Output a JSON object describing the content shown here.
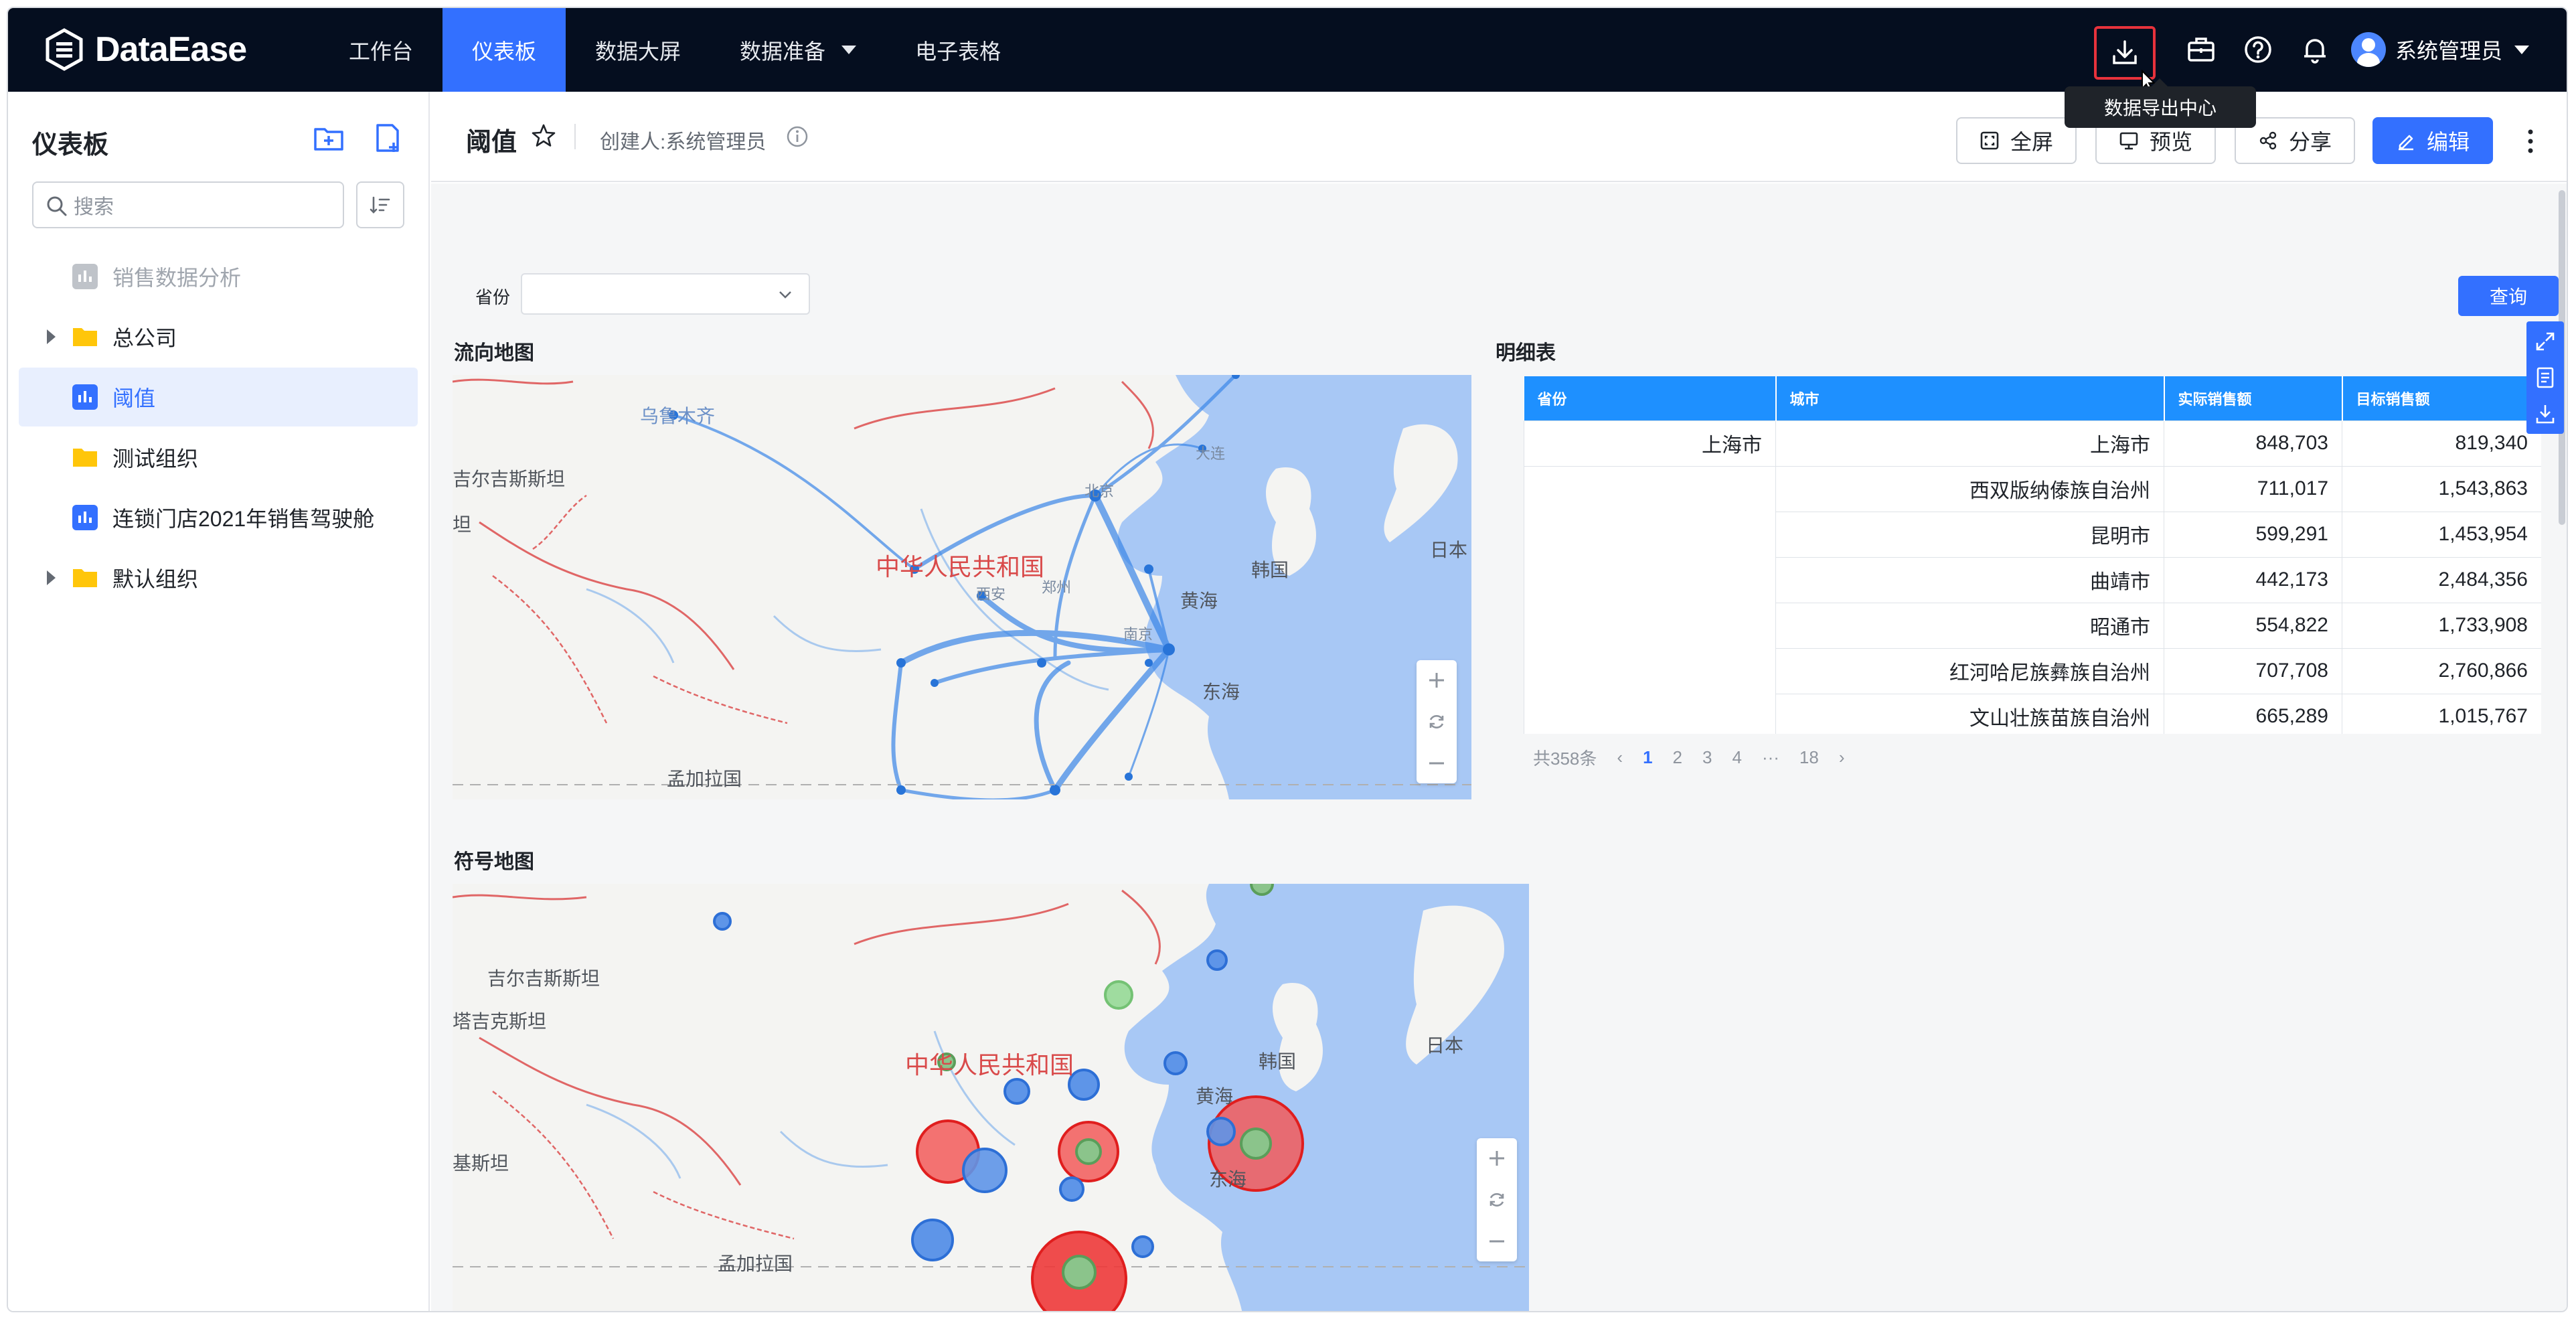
{
  "app": {
    "name": "DataEase"
  },
  "nav": {
    "items": [
      {
        "label": "工作台"
      },
      {
        "label": "仪表板"
      },
      {
        "label": "数据大屏"
      },
      {
        "label": "数据准备"
      },
      {
        "label": "电子表格"
      }
    ],
    "active": "仪表板",
    "user": "系统管理员",
    "tooltip": "数据导出中心"
  },
  "sidebar": {
    "title": "仪表板",
    "search_placeholder": "搜索",
    "items": [
      {
        "label": "销售数据分析",
        "type": "dashboard",
        "state": "muted"
      },
      {
        "label": "总公司",
        "type": "folder"
      },
      {
        "label": "阈值",
        "type": "dashboard",
        "state": "active"
      },
      {
        "label": "测试组织",
        "type": "folder"
      },
      {
        "label": "连锁门店2021年销售驾驶舱",
        "type": "dashboard"
      },
      {
        "label": "默认组织",
        "type": "folder"
      }
    ]
  },
  "header": {
    "title": "阈值",
    "creator": "创建人:系统管理员",
    "buttons": {
      "fullscreen": "全屏",
      "preview": "预览",
      "share": "分享",
      "edit": "编辑"
    }
  },
  "filter": {
    "label": "省份",
    "value": "",
    "query": "查询"
  },
  "flow_map": {
    "title": "流向地图",
    "labels": {
      "urumqi": "乌鲁木齐",
      "kyrgyz": "吉尔吉斯斯坦",
      "tan": "坦",
      "china": "中华人民共和国",
      "korea": "韩国",
      "japan": "日本",
      "yellow_sea": "黄海",
      "east_sea": "东海",
      "bangladesh": "孟加拉国",
      "xian": "西安",
      "zhengzhou": "郑州",
      "nanjing": "南京",
      "beijing": "北京",
      "dalian": "大连"
    }
  },
  "symbol_map": {
    "title": "符号地图",
    "labels": {
      "kazakh": "吉尔吉斯斯坦",
      "tajik": "塔吉克斯坦",
      "pakistan": "基斯坦",
      "china": "中华人民共和国",
      "korea": "韩国",
      "japan": "日本",
      "yellow_sea": "黄海",
      "east_sea": "东海",
      "bangladesh": "孟加拉国"
    }
  },
  "detail_table": {
    "title": "明细表",
    "columns": [
      "省份",
      "城市",
      "实际销售额",
      "目标销售额"
    ],
    "rows": [
      [
        "上海市",
        "上海市",
        "848,703",
        "819,340"
      ],
      [
        "",
        "西双版纳傣族自治州",
        "711,017",
        "1,543,863"
      ],
      [
        "",
        "昆明市",
        "599,291",
        "1,453,954"
      ],
      [
        "",
        "曲靖市",
        "442,173",
        "2,484,356"
      ],
      [
        "",
        "昭通市",
        "554,822",
        "1,733,908"
      ],
      [
        "",
        "红河哈尼族彝族自治州",
        "707,708",
        "2,760,866"
      ],
      [
        "",
        "文山壮族苗族自治州",
        "665,289",
        "1,015,767"
      ]
    ],
    "pager": {
      "total": "共358条",
      "pages": [
        "1",
        "2",
        "3",
        "4",
        "···",
        "18"
      ],
      "current": "1"
    }
  },
  "colors": {
    "nav_bg": "#050e1f",
    "accent": "#3370ff",
    "table_header": "#1e90ff",
    "alert": "#e8323c"
  }
}
